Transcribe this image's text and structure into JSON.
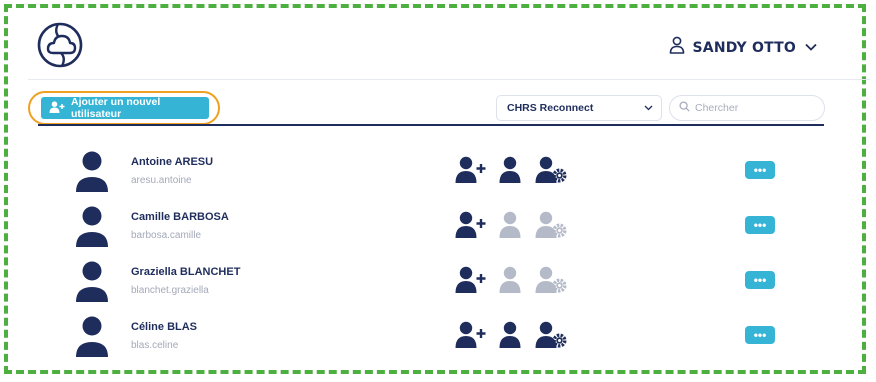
{
  "header": {
    "user_name": "SANDY OTTO"
  },
  "toolbar": {
    "add_user_label": "Ajouter un nouvel utilisateur",
    "organization_select": "CHRS Reconnect",
    "search_placeholder": "Chercher",
    "search_value": ""
  },
  "users": [
    {
      "name": "Antoine ARESU",
      "login": "aresu.antoine",
      "user_role_active": true,
      "admin_role_active": true,
      "more_label": "•••"
    },
    {
      "name": "Camille BARBOSA",
      "login": "barbosa.camille",
      "user_role_active": false,
      "admin_role_active": false,
      "more_label": "•••"
    },
    {
      "name": "Graziella BLANCHET",
      "login": "blanchet.graziella",
      "user_role_active": false,
      "admin_role_active": false,
      "more_label": "•••"
    },
    {
      "name": "Céline BLAS",
      "login": "blas.celine",
      "user_role_active": true,
      "admin_role_active": true,
      "more_label": "•••"
    }
  ],
  "colors": {
    "primary": "#1f2d5c",
    "accent": "#35b4d6",
    "inactive": "#b4bac8",
    "highlight": "#f0a020",
    "frame": "#4caf3f"
  },
  "icons": {
    "logo": "cloud-circle-logo",
    "user_menu": "user-outline-icon",
    "dropdown": "chevron-down-icon",
    "search": "search-icon",
    "add_user": "user-plus-icon",
    "role_user": "user-icon",
    "role_admin": "user-gear-icon",
    "more": "ellipsis-icon"
  }
}
